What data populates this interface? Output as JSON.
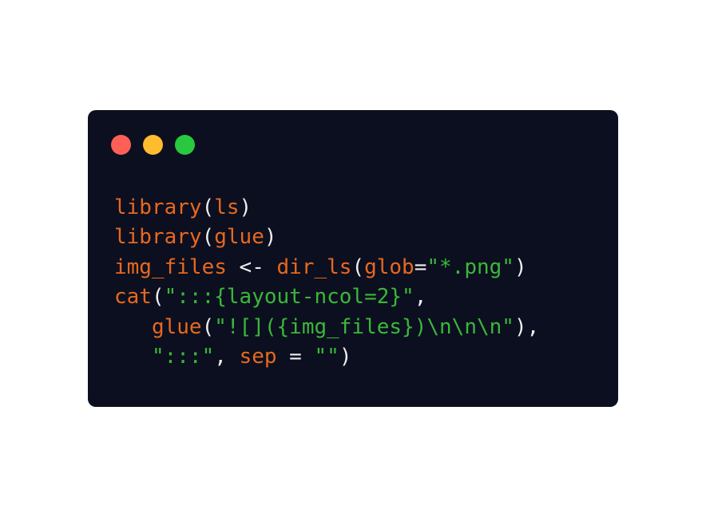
{
  "window": {
    "background": "#0c0f1f",
    "controls": [
      {
        "name": "close",
        "color": "#ff5f57"
      },
      {
        "name": "minimize",
        "color": "#febc2e"
      },
      {
        "name": "maximize",
        "color": "#28c840"
      }
    ]
  },
  "colors": {
    "function": "#e8681f",
    "string": "#39b83a",
    "plain": "#eeeeee"
  },
  "code": {
    "lines": [
      [
        {
          "t": "fn",
          "v": "library"
        },
        {
          "t": "plain",
          "v": "("
        },
        {
          "t": "fn",
          "v": "ls"
        },
        {
          "t": "plain",
          "v": ")"
        }
      ],
      [
        {
          "t": "fn",
          "v": "library"
        },
        {
          "t": "plain",
          "v": "("
        },
        {
          "t": "fn",
          "v": "glue"
        },
        {
          "t": "plain",
          "v": ")"
        }
      ],
      [
        {
          "t": "fn",
          "v": "img_files"
        },
        {
          "t": "plain",
          "v": " <- "
        },
        {
          "t": "fn",
          "v": "dir_ls"
        },
        {
          "t": "plain",
          "v": "("
        },
        {
          "t": "fn",
          "v": "glob"
        },
        {
          "t": "plain",
          "v": "="
        },
        {
          "t": "str",
          "v": "\"*.png\""
        },
        {
          "t": "plain",
          "v": ")"
        }
      ],
      [
        {
          "t": "fn",
          "v": "cat"
        },
        {
          "t": "plain",
          "v": "("
        },
        {
          "t": "str",
          "v": "\":::{layout-ncol=2}\""
        },
        {
          "t": "plain",
          "v": ","
        }
      ],
      [
        {
          "t": "plain",
          "v": "   "
        },
        {
          "t": "fn",
          "v": "glue"
        },
        {
          "t": "plain",
          "v": "("
        },
        {
          "t": "str",
          "v": "\"![]({img_files})\\n\\n\\n\""
        },
        {
          "t": "plain",
          "v": "),"
        }
      ],
      [
        {
          "t": "plain",
          "v": "   "
        },
        {
          "t": "str",
          "v": "\":::\""
        },
        {
          "t": "plain",
          "v": ", "
        },
        {
          "t": "fn",
          "v": "sep"
        },
        {
          "t": "plain",
          "v": " = "
        },
        {
          "t": "str",
          "v": "\"\""
        },
        {
          "t": "plain",
          "v": ")"
        }
      ]
    ]
  }
}
